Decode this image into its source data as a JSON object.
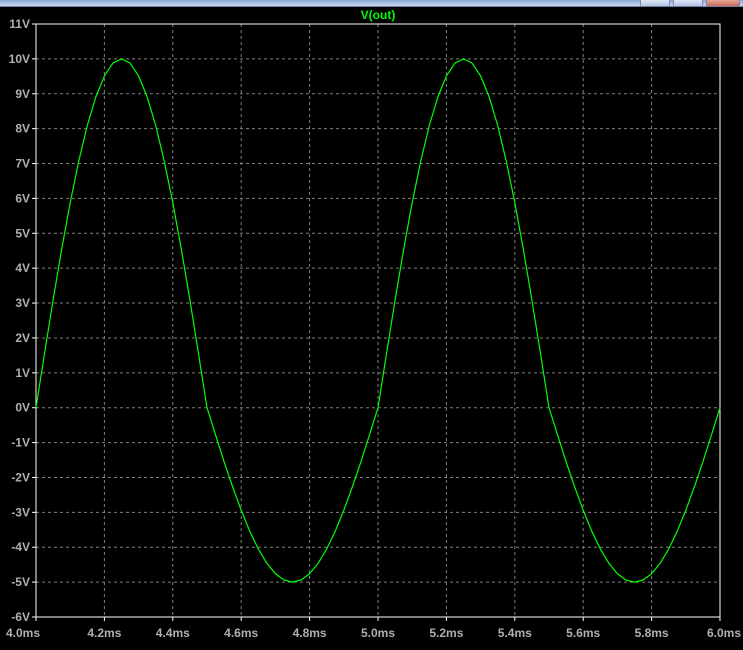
{
  "window": {
    "title": ""
  },
  "chart_data": {
    "type": "line",
    "title": "V(out)",
    "xlabel": "",
    "ylabel": "",
    "x_unit": "ms",
    "y_unit": "V",
    "xlim": [
      4.0,
      6.0
    ],
    "ylim": [
      -6,
      11
    ],
    "x_ticks": [
      "4.0ms",
      "4.2ms",
      "4.4ms",
      "4.6ms",
      "4.8ms",
      "5.0ms",
      "5.2ms",
      "5.4ms",
      "5.6ms",
      "5.8ms",
      "6.0ms"
    ],
    "y_ticks": [
      "11V",
      "10V",
      "9V",
      "8V",
      "7V",
      "6V",
      "5V",
      "4V",
      "3V",
      "2V",
      "1V",
      "0V",
      "-1V",
      "-2V",
      "-3V",
      "-4V",
      "-5V",
      "-6V"
    ],
    "grid": true,
    "colors": {
      "background": "#000000",
      "frame": "#ffffff",
      "grid": "#808080",
      "trace": "#00ff00",
      "tick_labels": "#b0b0b0"
    },
    "series": [
      {
        "name": "V(out)",
        "x": [
          4.0,
          4.025,
          4.05,
          4.075,
          4.1,
          4.125,
          4.15,
          4.175,
          4.2,
          4.225,
          4.25,
          4.275,
          4.3,
          4.325,
          4.35,
          4.375,
          4.4,
          4.425,
          4.45,
          4.475,
          4.5,
          4.525,
          4.55,
          4.575,
          4.6,
          4.625,
          4.65,
          4.675,
          4.7,
          4.725,
          4.75,
          4.775,
          4.8,
          4.825,
          4.85,
          4.875,
          4.9,
          4.925,
          4.95,
          4.975,
          5.0,
          5.025,
          5.05,
          5.075,
          5.1,
          5.125,
          5.15,
          5.175,
          5.2,
          5.225,
          5.25,
          5.275,
          5.3,
          5.325,
          5.35,
          5.375,
          5.4,
          5.425,
          5.45,
          5.475,
          5.5,
          5.525,
          5.55,
          5.575,
          5.6,
          5.625,
          5.65,
          5.675,
          5.7,
          5.725,
          5.75,
          5.775,
          5.8,
          5.825,
          5.85,
          5.875,
          5.9,
          5.925,
          5.95,
          5.975,
          6.0
        ],
        "values": [
          0.0,
          1.56,
          3.09,
          4.54,
          5.88,
          7.07,
          8.09,
          8.91,
          9.51,
          9.88,
          10.0,
          9.88,
          9.51,
          8.91,
          8.09,
          7.07,
          5.88,
          4.54,
          3.09,
          1.56,
          0.0,
          -0.78,
          -1.55,
          -2.27,
          -2.94,
          -3.54,
          -4.05,
          -4.46,
          -4.76,
          -4.94,
          -5.0,
          -4.94,
          -4.76,
          -4.46,
          -4.05,
          -3.54,
          -2.94,
          -2.27,
          -1.55,
          -0.78,
          0.0,
          1.56,
          3.09,
          4.54,
          5.88,
          7.07,
          8.09,
          8.91,
          9.51,
          9.88,
          10.0,
          9.88,
          9.51,
          8.91,
          8.09,
          7.07,
          5.88,
          4.54,
          3.09,
          1.56,
          0.0,
          -0.78,
          -1.55,
          -2.27,
          -2.94,
          -3.54,
          -4.05,
          -4.46,
          -4.76,
          -4.94,
          -5.0,
          -4.94,
          -4.76,
          -4.46,
          -4.05,
          -3.54,
          -2.94,
          -2.27,
          -1.55,
          -0.78,
          0.0
        ]
      }
    ]
  }
}
